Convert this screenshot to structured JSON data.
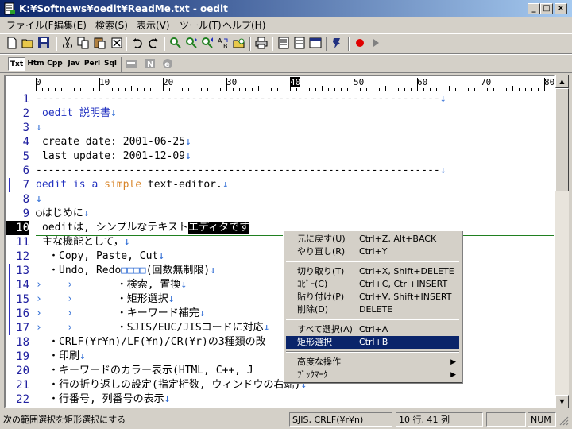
{
  "window": {
    "title": "K:¥Softnews¥oedit¥ReadMe.txt - oedit",
    "minimize": "_",
    "maximize": "□",
    "close": "×"
  },
  "menu": [
    "ファイル(F)",
    "編集(E)",
    "検索(S)",
    "表示(V)",
    "ツール(T)",
    "ヘルプ(H)"
  ],
  "toolbar2": [
    "Txt",
    "Htm",
    "Cpp",
    "Jav",
    "Perl",
    "Sql"
  ],
  "ruler": [
    "0",
    "10",
    "20",
    "30",
    "40",
    "50",
    "60",
    "70",
    "80"
  ],
  "line_numbers": [
    "1",
    "2",
    "3",
    "4",
    "5",
    "6",
    "7",
    "8",
    "9",
    "10",
    "11",
    "12",
    "13",
    "14",
    "15",
    "16",
    "17",
    "18",
    "19",
    "20",
    "21",
    "22"
  ],
  "lines": {
    "l1": "-----------------------------------------------------------------",
    "l2": "oedit 説明書",
    "l4": "create date: 2001-06-25",
    "l5": "last update: 2001-12-09",
    "l6": "-----------------------------------------------------------------",
    "l7a": "oedit is a ",
    "l7b": "simple",
    "l7c": " text-editor.",
    "l9": "○はじめに",
    "l10a": "oeditは, シンプルなテキスト",
    "l10b": "エディタです",
    "l11": "主な機能として，",
    "l12": "・Copy, Paste, Cut",
    "l13a": "・Undo, Redo",
    "l13b": "□□□□",
    "l13c": "(回数無制限)",
    "l14": "・検索, 置換",
    "l15": "・矩形選択",
    "l16": "・キーワード補完",
    "l17": "・SJIS/EUC/JISコードに対応",
    "l18": "・CRLF(¥r¥n)/LF(¥n)/CR(¥r)の3種類の改",
    "l19": "・印刷",
    "l20": "・キーワードのカラー表示(HTML, C++, J",
    "l21": "・行の折り返しの設定(指定桁数, ウィンドウの右端)",
    "l22": "・行番号, 列番号の表示",
    "ret": "↓",
    "tab": "›"
  },
  "context_menu": [
    {
      "label": "元に戻す(U)",
      "accel": "Ctrl+Z, Alt+BACK"
    },
    {
      "label": "やり直し(R)",
      "accel": "Ctrl+Y"
    },
    {
      "label": "切り取り(T)",
      "accel": "Ctrl+X, Shift+DELETE"
    },
    {
      "label": "ｺﾋﾟｰ(C)",
      "accel": "Ctrl+C, Ctrl+INSERT"
    },
    {
      "label": "貼り付け(P)",
      "accel": "Ctrl+V, Shift+INSERT"
    },
    {
      "label": "削除(D)",
      "accel": "DELETE"
    },
    {
      "label": "すべて選択(A)",
      "accel": "Ctrl+A"
    },
    {
      "label": "矩形選択",
      "accel": "Ctrl+B"
    },
    {
      "label": "高度な操作",
      "accel": ""
    },
    {
      "label": "ﾌﾞｯｸﾏｰｸ",
      "accel": ""
    }
  ],
  "status": {
    "message": "次の範囲選択を矩形選択にする",
    "encoding": "SJIS, CRLF(¥r¥n)",
    "position": "10 行, 41 列",
    "numlock": "NUM"
  },
  "colors": {
    "title_start": "#0a246a",
    "title_end": "#a6caf0",
    "keyword": "#d9862b",
    "line_numbers": "#2020a0",
    "newline_marks": "#2d6bd4"
  }
}
